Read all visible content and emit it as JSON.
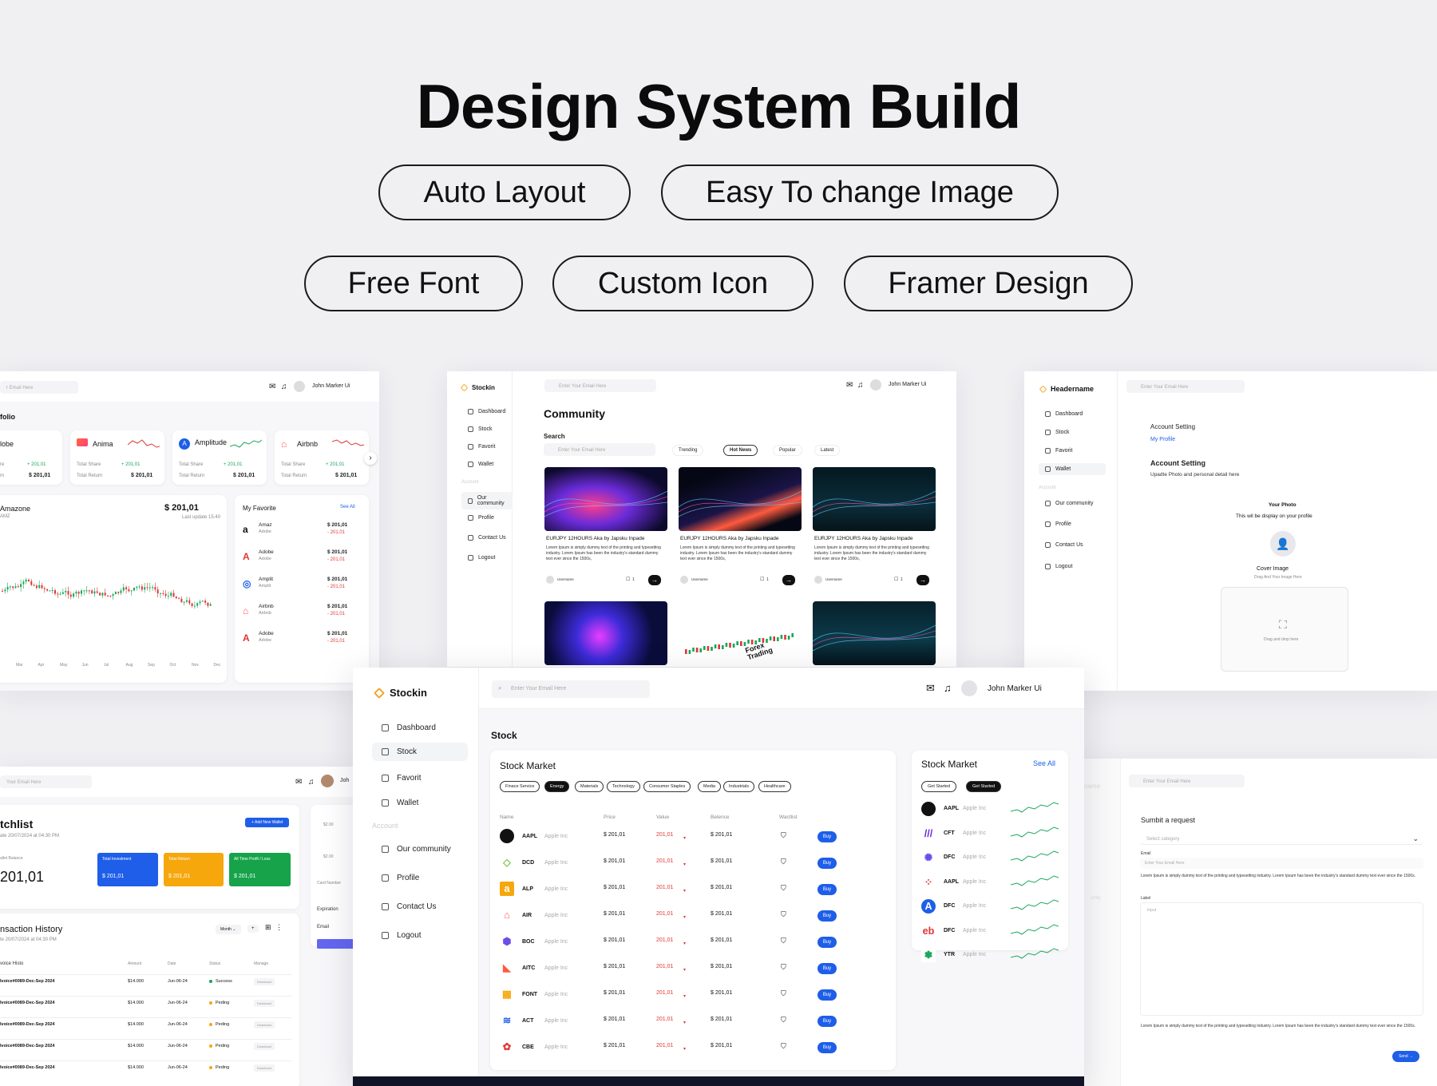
{
  "hero": {
    "title": "Design System Build",
    "pills": [
      "Auto Layout",
      "Easy To change Image",
      "Free Font",
      "Custom Icon",
      "Framer Design"
    ]
  },
  "search_placeholder": "Enter Your Email Here",
  "user_name": "John Marker Ui",
  "brand": "Stockin",
  "brand_alt": "Headername",
  "sidebar": {
    "items": [
      "Dashboard",
      "Stock",
      "Favorit",
      "Wallet"
    ],
    "section": "Account",
    "account_items": [
      "Our community",
      "Profile",
      "Contact Us",
      "Logout"
    ]
  },
  "portfolio": {
    "title": "folio",
    "cards": [
      {
        "name": "lobe",
        "change": "+ 201,01",
        "value": "$ 201,01",
        "l1": "re",
        "l2": "rn"
      },
      {
        "name": "Anima",
        "change": "+ 201,01",
        "value": "$ 201,01",
        "l1": "Total Share",
        "l2": "Total Return"
      },
      {
        "name": "Amplitude",
        "change": "+ 201,01",
        "value": "$ 201,01",
        "l1": "Total Share",
        "l2": "Total Return"
      },
      {
        "name": "Airbnb",
        "change": "+ 201,01",
        "value": "$ 201,01",
        "l1": "Total Share",
        "l2": "Total Return"
      }
    ],
    "chart_title": "Amazone",
    "chart_sub": "AMZ",
    "chart_value": "$ 201,01",
    "chart_meta": "Last update 15.40",
    "chart_months": [
      "Mar",
      "Apr",
      "May",
      "Jun",
      "Jul",
      "Aug",
      "Sep",
      "Oct",
      "Nov",
      "Dec"
    ],
    "favorite_title": "My Favorite",
    "see_all": "See All",
    "favorites": [
      {
        "name": "Amaz",
        "sub": "Adobe",
        "value": "$ 201,01",
        "change": "- 201,01"
      },
      {
        "name": "Adobe",
        "sub": "Adobe",
        "value": "$ 201,01",
        "change": "- 201,01"
      },
      {
        "name": "Amplit",
        "sub": "Amplit",
        "value": "$ 201,01",
        "change": "- 201,01"
      },
      {
        "name": "Airbnb",
        "sub": "Airbnb",
        "value": "$ 201,01",
        "change": "- 201,01"
      },
      {
        "name": "Adobe",
        "sub": "Adobe",
        "value": "$ 201,01",
        "change": "- 201,01"
      }
    ]
  },
  "community": {
    "title": "Community",
    "search_label": "Search",
    "tabs": [
      "Trending",
      "Hot News",
      "Popular",
      "Latest"
    ],
    "post_title": "EURJPY 12HOURS Aka by Japsku Inpade",
    "post_body": "Lorem Ipsum is simply dummy text of the printing and typesetting industry. Lorem Ipsum has been the industry's standard dummy text ever since the 1500s,",
    "username": "Username",
    "comments": "1",
    "forex_label": "Forex Trading"
  },
  "account": {
    "title": "Account Setting",
    "tab": "My Profile",
    "subtitle": "Account Setting",
    "desc": "Upadte Photo and personal detail here",
    "photo_title": "Your Photo",
    "photo_desc": "This wil be display on your profile",
    "cover_title": "Cover Image",
    "cover_desc": "Drag And Your Image Here",
    "drop_text": "Drag and drop here"
  },
  "watchlist": {
    "title": "tchlist",
    "date": "ate 20/07/2024 at 04:30 PM",
    "add_button": "+ Add New Wallet",
    "balance_label": "allet Balance",
    "balance": "201,01",
    "tiles": [
      {
        "label": "Total Investment",
        "value": "$ 201,01"
      },
      {
        "label": "Total Return",
        "value": "$ 201,01"
      },
      {
        "label": "All Time Profit / Loss",
        "value": "$ 201,01"
      }
    ],
    "history_title": "nsaction History",
    "history_date": "te 20/07/2024 at 04:30 PM",
    "filter": "Month",
    "columns": [
      "voice Histo",
      "Amount",
      "Date",
      "Status",
      "Manage"
    ],
    "rows": [
      {
        "id": "Ivoice#0089-Dec-Sep 2024",
        "amount": "$14.000",
        "date": "Jun-06-24",
        "status": "Success",
        "manage": "Download"
      },
      {
        "id": "Ivoice#0089-Dec-Sep 2024",
        "amount": "$14.000",
        "date": "Jun-06-24",
        "status": "Peding",
        "manage": "Download"
      },
      {
        "id": "Ivoice#0089-Dec-Sep 2024",
        "amount": "$14.000",
        "date": "Jun-06-24",
        "status": "Peding",
        "manage": "Download"
      },
      {
        "id": "Ivoice#0089-Dec-Sep 2024",
        "amount": "$14.000",
        "date": "Jun-06-24",
        "status": "Peding",
        "manage": "Download"
      },
      {
        "id": "Ivoice#0089-Dec-Sep 2024",
        "amount": "$14.000",
        "date": "Jun-06-24",
        "status": "Peding",
        "manage": "Download"
      }
    ],
    "side_labels": [
      "Card Number",
      "Expiration",
      "Email"
    ],
    "side_values": [
      "$2.00",
      "$2.00"
    ]
  },
  "stock": {
    "page_title": "Stock",
    "market_title": "Stock Market",
    "categories": [
      "Finace Service",
      "Energy",
      "Materials",
      "Technology",
      "Consumer Staples",
      "Media",
      "Industrials",
      "Healthcare"
    ],
    "columns": [
      "Name",
      "Price",
      "Value",
      "Belence",
      "Wactlist"
    ],
    "buy": "Buy",
    "rows": [
      {
        "ticker": "AAPL",
        "company": "Apple Inc",
        "price": "$ 201,01",
        "value": "201,01",
        "balance": "$ 201,01",
        "icon": "apple-logo-icon"
      },
      {
        "ticker": "DCD",
        "company": "Apple Inc",
        "price": "$ 201,01",
        "value": "201,01",
        "balance": "$ 201,01",
        "icon": "diamond-logo-icon"
      },
      {
        "ticker": "ALP",
        "company": "Apple Inc",
        "price": "$ 201,01",
        "value": "201,01",
        "balance": "$ 201,01",
        "icon": "amazon-logo-icon"
      },
      {
        "ticker": "AIR",
        "company": "Apple Inc",
        "price": "$ 201,01",
        "value": "201,01",
        "balance": "$ 201,01",
        "icon": "airbnb-logo-icon"
      },
      {
        "ticker": "BOC",
        "company": "Apple Inc",
        "price": "$ 201,01",
        "value": "201,01",
        "balance": "$ 201,01",
        "icon": "cube-logo-icon"
      },
      {
        "ticker": "AITC",
        "company": "Apple Inc",
        "price": "$ 201,01",
        "value": "201,01",
        "balance": "$ 201,01",
        "icon": "flag-logo-icon"
      },
      {
        "ticker": "FONT",
        "company": "Apple Inc",
        "price": "$ 201,01",
        "value": "201,01",
        "balance": "$ 201,01",
        "icon": "blocks-logo-icon"
      },
      {
        "ticker": "ACT",
        "company": "Apple Inc",
        "price": "$ 201,01",
        "value": "201,01",
        "balance": "$ 201,01",
        "icon": "swoosh-logo-icon"
      },
      {
        "ticker": "CBE",
        "company": "Apple Inc",
        "price": "$ 201,01",
        "value": "201,01",
        "balance": "$ 201,01",
        "icon": "petals-logo-icon"
      }
    ],
    "side_title": "Stock Market",
    "side_see_all": "See All",
    "side_tabs": [
      "Get Started",
      "Get Started"
    ],
    "side_rows": [
      {
        "ticker": "AAPL",
        "company": "Apple Inc",
        "icon": "apple-logo-icon"
      },
      {
        "ticker": "CFT",
        "company": "Apple Inc",
        "icon": "stripes-logo-icon"
      },
      {
        "ticker": "DFC",
        "company": "Apple Inc",
        "icon": "sun-logo-icon"
      },
      {
        "ticker": "AAPL",
        "company": "Apple Inc",
        "icon": "dots-logo-icon"
      },
      {
        "ticker": "DFC",
        "company": "Apple Inc",
        "icon": "a-logo-icon"
      },
      {
        "ticker": "DFC",
        "company": "Apple Inc",
        "icon": "ebay-logo-icon"
      },
      {
        "ticker": "YTR",
        "company": "Apple Inc",
        "icon": "leaf-logo-icon"
      }
    ]
  },
  "request": {
    "title": "Sumbit a request",
    "select": "Select category",
    "email_label": "Email",
    "email_placeholder": "Enter Your Email Here",
    "body": "Lorem Ipsum is simply dummy text of the printing and typesetting industry. Lorem Ipsum has been the industry's standard dummy text ever since the 1500s.",
    "label": "Label",
    "textarea_placeholder": "Input",
    "send": "Send"
  },
  "colors": {
    "accent": "#1e5ee8",
    "brand": "#f2a62b",
    "negative": "#e03636",
    "positive": "#18a65a"
  }
}
